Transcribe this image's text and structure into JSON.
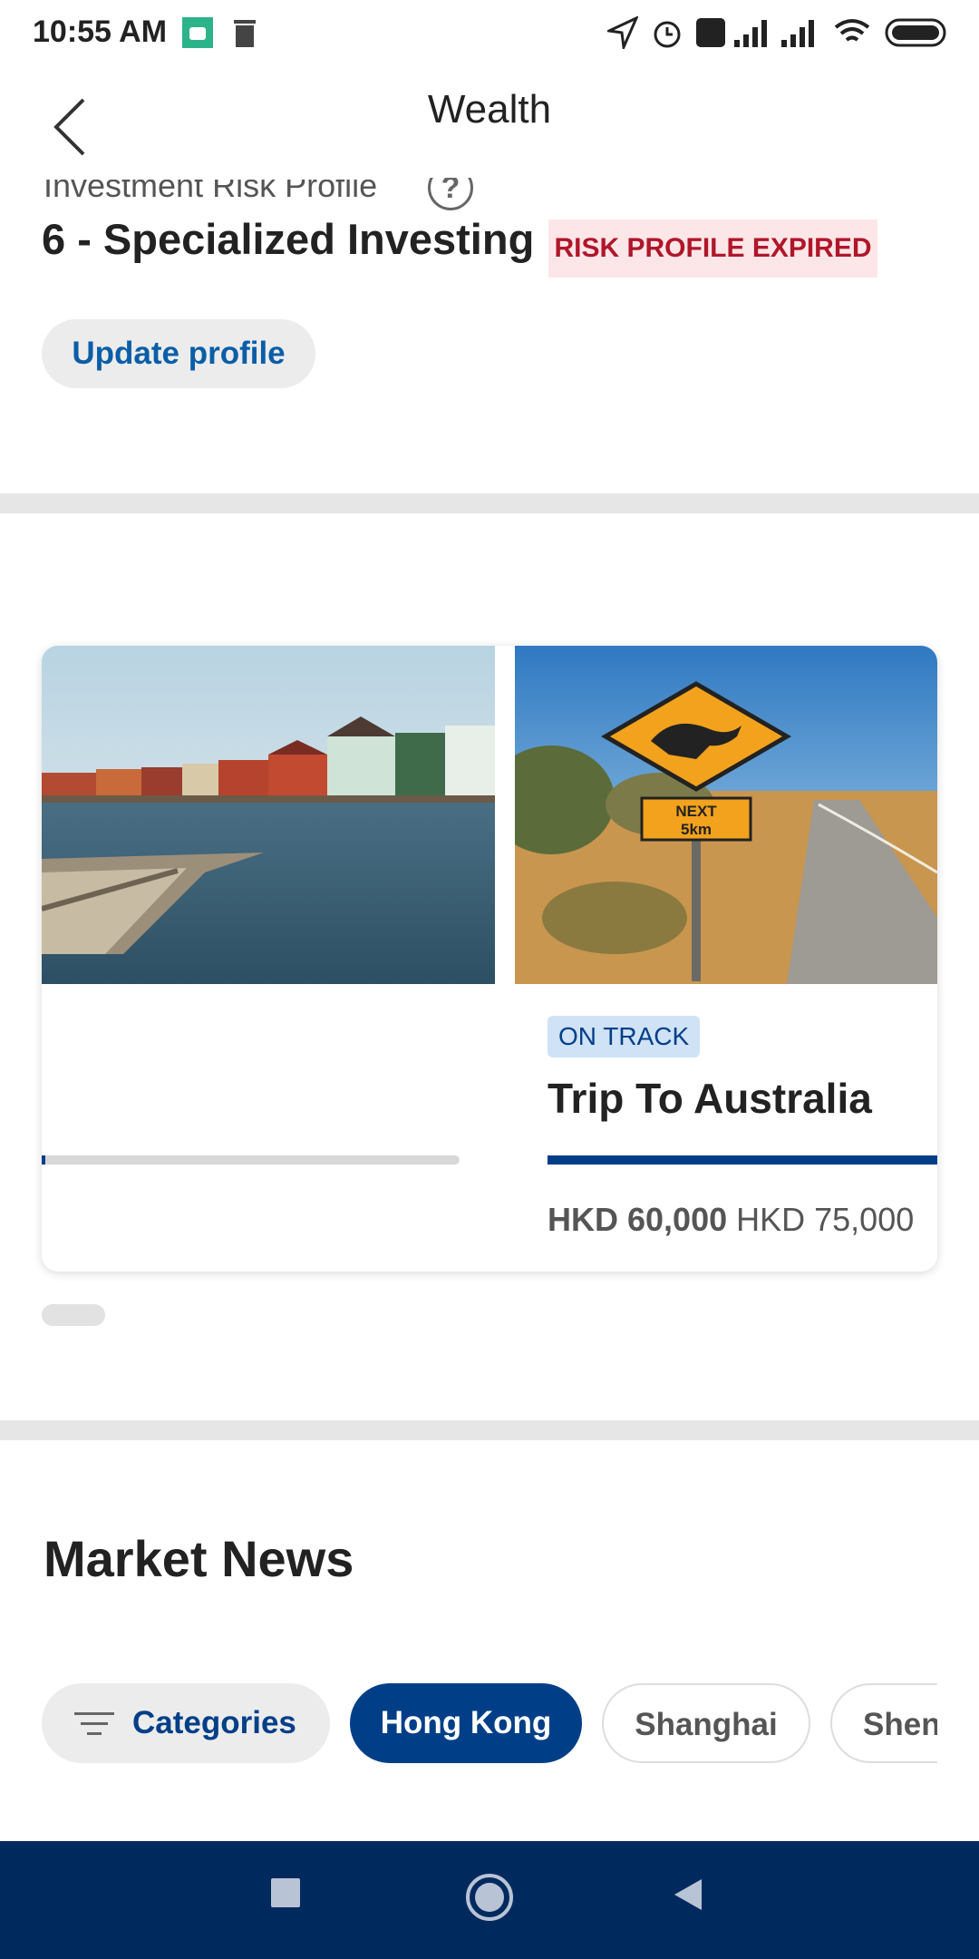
{
  "status_bar": {
    "time": "10:55 AM"
  },
  "header": {
    "title": "Wealth"
  },
  "risk_profile": {
    "label": "Investment Risk Profile",
    "value": "6 - Specialized Investing",
    "badge": "RISK PROFILE EXPIRED",
    "update_button": "Update profile"
  },
  "goals": {
    "cards": [
      {
        "image": "harbor-houses-photo",
        "progress": 0.01
      },
      {
        "image": "kangaroo-road-sign-photo",
        "status": "ON TRACK",
        "title": "Trip To Australia",
        "current_amount": "HKD 60,000",
        "target_amount": "HKD 75,000",
        "progress": 1.0
      }
    ]
  },
  "market_news": {
    "title": "Market News",
    "chips": [
      "Categories",
      "Hong Kong",
      "Shanghai",
      "Shenzhen"
    ],
    "selected": "Hong Kong"
  },
  "colors": {
    "primary": "#003f87",
    "badge_red": "#b0162a",
    "badge_bg": "#fde6e8",
    "nav_bar": "#002a5e"
  }
}
